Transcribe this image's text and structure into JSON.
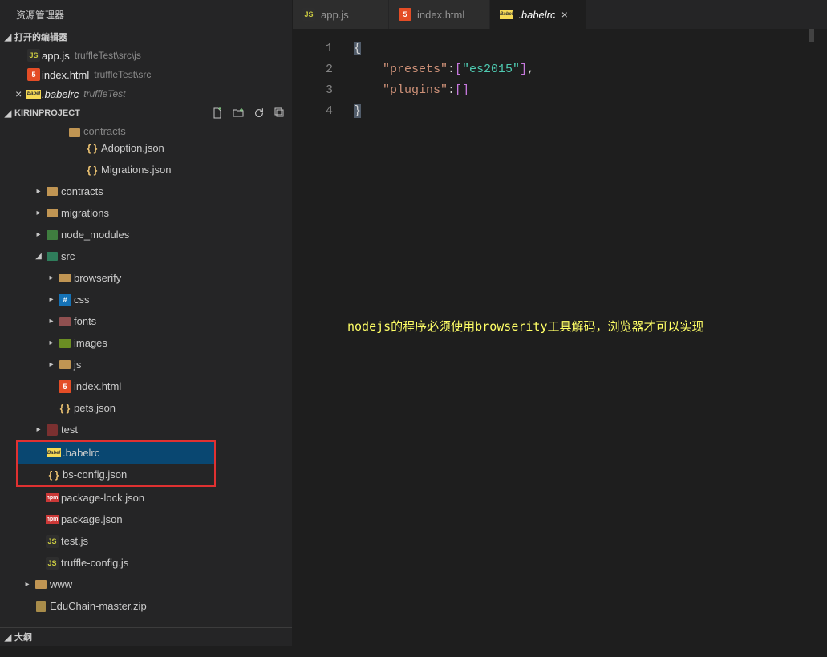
{
  "sidebar": {
    "title": "资源管理器",
    "open_editors": {
      "header": "打开的编辑器",
      "items": [
        {
          "name": "app.js",
          "path": "truffleTest\\src\\js",
          "icon": "js",
          "close": false
        },
        {
          "name": "index.html",
          "path": "truffleTest\\src",
          "icon": "html",
          "close": false
        },
        {
          "name": ".babelrc",
          "path": "truffleTest",
          "icon": "babel",
          "close": true,
          "italic": true
        }
      ]
    },
    "project": {
      "header": "KIRINPROJECT",
      "tree": [
        {
          "indent": 70,
          "chev": "",
          "icon": "folder",
          "label": "contracts",
          "dim": true,
          "halfcut": true
        },
        {
          "indent": 92,
          "chev": "",
          "icon": "braces",
          "label": "Adoption.json"
        },
        {
          "indent": 92,
          "chev": "",
          "icon": "braces",
          "label": "Migrations.json"
        },
        {
          "indent": 42,
          "chev": "▸",
          "icon": "folder",
          "label": "contracts"
        },
        {
          "indent": 42,
          "chev": "▸",
          "icon": "folder",
          "label": "migrations"
        },
        {
          "indent": 42,
          "chev": "▸",
          "icon": "nm",
          "label": "node_modules"
        },
        {
          "indent": 42,
          "chev": "◢",
          "icon": "folder-green",
          "label": "src"
        },
        {
          "indent": 58,
          "chev": "▸",
          "icon": "folder",
          "label": "browserify"
        },
        {
          "indent": 58,
          "chev": "▸",
          "icon": "css",
          "label": "css"
        },
        {
          "indent": 58,
          "chev": "▸",
          "icon": "font",
          "label": "fonts"
        },
        {
          "indent": 58,
          "chev": "▸",
          "icon": "img",
          "label": "images"
        },
        {
          "indent": 58,
          "chev": "▸",
          "icon": "folder",
          "label": "js"
        },
        {
          "indent": 58,
          "chev": "",
          "icon": "html",
          "label": "index.html"
        },
        {
          "indent": 58,
          "chev": "",
          "icon": "braces",
          "label": "pets.json"
        },
        {
          "indent": 42,
          "chev": "▸",
          "icon": "test",
          "label": "test"
        },
        {
          "indent": 42,
          "chev": "",
          "icon": "babel",
          "label": ".babelrc",
          "selected": true,
          "redbox": "top"
        },
        {
          "indent": 42,
          "chev": "",
          "icon": "braces",
          "label": "bs-config.json",
          "redbox": "bottom"
        },
        {
          "indent": 42,
          "chev": "",
          "icon": "npm",
          "label": "package-lock.json"
        },
        {
          "indent": 42,
          "chev": "",
          "icon": "npm",
          "label": "package.json"
        },
        {
          "indent": 42,
          "chev": "",
          "icon": "js",
          "label": "test.js"
        },
        {
          "indent": 42,
          "chev": "",
          "icon": "js",
          "label": "truffle-config.js"
        },
        {
          "indent": 28,
          "chev": "▸",
          "icon": "folder",
          "label": "www"
        },
        {
          "indent": 28,
          "chev": "",
          "icon": "zip",
          "label": "EduChain-master.zip"
        }
      ]
    },
    "outline": "大纲"
  },
  "tabs": [
    {
      "icon": "js",
      "label": "app.js",
      "active": false
    },
    {
      "icon": "html",
      "label": "index.html",
      "active": false
    },
    {
      "icon": "babel",
      "label": ".babelrc",
      "active": true
    }
  ],
  "editor": {
    "lines": [
      1,
      2,
      3,
      4
    ],
    "code": {
      "l1": "{",
      "l2a": "\"presets\"",
      "l2b": ":",
      "l2c": "[",
      "l2d": "\"es2015\"",
      "l2e": "]",
      "l2f": ",",
      "l3a": "\"plugins\"",
      "l3b": ":",
      "l3c": "[]",
      "l4": "}"
    },
    "annotation": "nodejs的程序必须使用browserity工具解码，浏览器才可以实现"
  }
}
